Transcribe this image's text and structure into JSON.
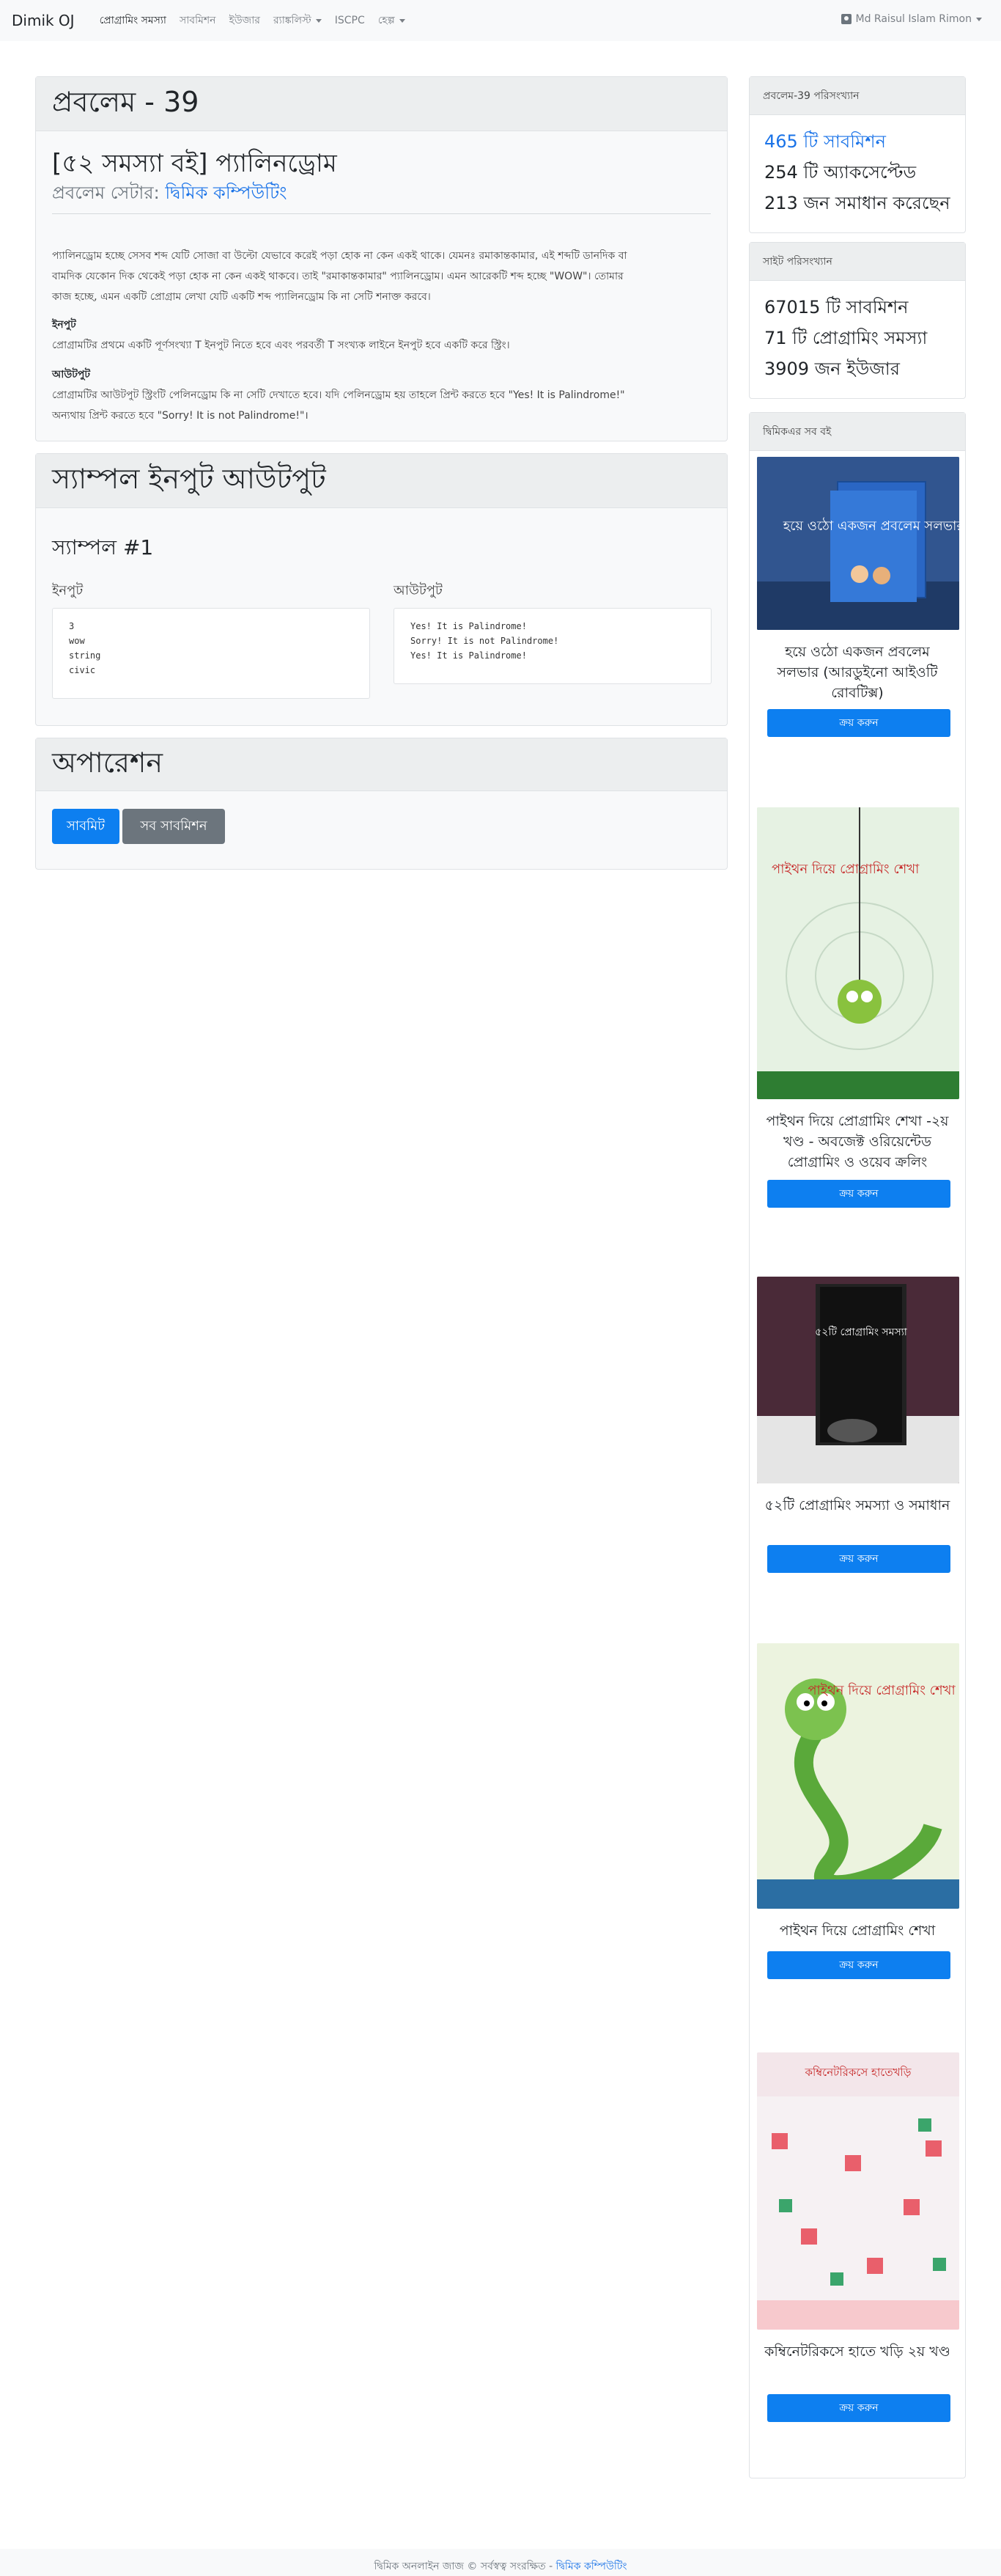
{
  "navbar": {
    "brand": "Dimik OJ",
    "items": [
      {
        "label": "প্রোগ্রামিং সমস্যা",
        "active": true,
        "dropdown": false
      },
      {
        "label": "সাবমিশন",
        "active": false,
        "dropdown": false
      },
      {
        "label": "ইউজার",
        "active": false,
        "dropdown": false
      },
      {
        "label": "র‍্যাঙ্কলিস্ট",
        "active": false,
        "dropdown": true
      },
      {
        "label": "ISCPC",
        "active": false,
        "dropdown": false
      },
      {
        "label": "হেল্প",
        "active": false,
        "dropdown": true
      }
    ],
    "user": "Md Raisul Islam Rimon"
  },
  "problem": {
    "header": "প্রবলেম - 39",
    "title": "[৫২ সমস্যা বই] প্যালিনড্রোম",
    "setter_prefix": "প্রবলেম সেটার: ",
    "setter_name": "দ্বিমিক কম্পিউটিং",
    "description_line1": "প্যালিনড্রোম হচ্ছে সেসব শব্দ যেটি সোজা বা উল্টো যেভাবে করেই পড়া হোক না কেন একই থাকে। যেমনঃ রমাকান্তকামার, এই শব্দটি ডানদিক বা",
    "description_line2": "বামদিক যেকোন দিক থেকেই পড়া হোক না কেন একই থাকবে। তাই \"রমাকান্তকামার\" প্যালিনড্রোম। এমন আরেকটি শব্দ হচ্ছে \"WOW\"। তোমার",
    "description_line3": "কাজ হচ্ছে, এমন একটি প্রোগ্রাম লেখা যেটি একটি শব্দ প্যালিনড্রোম কি না সেটি শনাক্ত করবে।",
    "input_heading": "ইনপুট",
    "input_text": "প্রোগ্রামটির প্রথমে একটি পূর্ণসংখ্যা T ইনপুট নিতে হবে এবং পরবর্তী T সংখ্যক লাইনে ইনপুট হবে একটি করে স্ট্রিং।",
    "output_heading": "আউটপুট",
    "output_line1": "প্রোগ্রামটির আউটপুট স্ট্রিংটি পেলিনড্রোম কি না সেটি দেখাতে হবে। যদি পেলিনড্রোম হয় তাহলে প্রিন্ট করতে হবে \"Yes! It is Palindrome!\"",
    "output_line2": "অন্যথায় প্রিন্ট করতে হবে \"Sorry! It is not Palindrome!\"।"
  },
  "sample": {
    "header": "স্যাম্পল ইনপুট আউটপুট",
    "title": "স্যাম্পল #1",
    "input_label": "ইনপুট",
    "output_label": "আউটপুট",
    "input_text": "3\nwow\nstring\ncivic",
    "output_text": "Yes! It is Palindrome!\nSorry! It is not Palindrome!\nYes! It is Palindrome!"
  },
  "operations": {
    "header": "অপারেশন",
    "submit_label": "সাবমিট",
    "all_submissions_label": "সব সাবমিশন"
  },
  "problem_stats": {
    "header": "প্রবলেম-39 পরিসংখ্যান",
    "submissions": "465 টি সাবমিশন",
    "accepted": "254 টি অ্যাকসেপ্টেড",
    "solvers": "213 জন সমাধান করেছেন"
  },
  "site_stats": {
    "header": "সাইট পরিসংখ্যান",
    "submissions": "67015 টি সাবমিশন",
    "problems": "71 টি প্রোগ্রামিং সমস্যা",
    "users": "3909 জন ইউজার"
  },
  "books": {
    "header": "দ্বিমিকএর সব বই",
    "buy_label": "ক্রয় করুন",
    "items": [
      {
        "title": "হয়ে ওঠো একজন প্রবলেম সলভার (আরডুইনো আইওটি রোবটিক্স)",
        "cover_text": "হয়ে ওঠো একজন প্রবলেম সলভার"
      },
      {
        "title": "পাইথন দিয়ে প্রোগ্রামিং শেখা -২য় খণ্ড - অবজেক্ট ওরিয়েন্টেড প্রোগ্রামিং ও ওয়েব ক্রলিং",
        "cover_text": "পাইথন দিয়ে প্রোগ্রামিং শেখা"
      },
      {
        "title": "৫২টি প্রোগ্রামিং সমস্যা ও সমাধান",
        "cover_text": "৫২টি প্রোগ্রামিং সমস্যা"
      },
      {
        "title": "পাইথন দিয়ে প্রোগ্রামিং শেখা",
        "cover_text": "পাইথন দিয়ে প্রোগ্রামিং শেখা"
      },
      {
        "title": "কম্বিনেটরিকসে হাতে খড়ি ২য় খণ্ড",
        "cover_text": "কম্বিনেটরিকসে হাতেখড়ি"
      }
    ]
  },
  "footer": {
    "text": "দ্বিমিক অনলাইন জাজ © সর্বস্বত্ব সংরক্ষিত - ",
    "link": "দ্বিমিক কম্পিউটিং"
  },
  "colors": {
    "accent": "#0d7ff0",
    "link": "#1a73e8",
    "secondary": "#6c757d"
  }
}
